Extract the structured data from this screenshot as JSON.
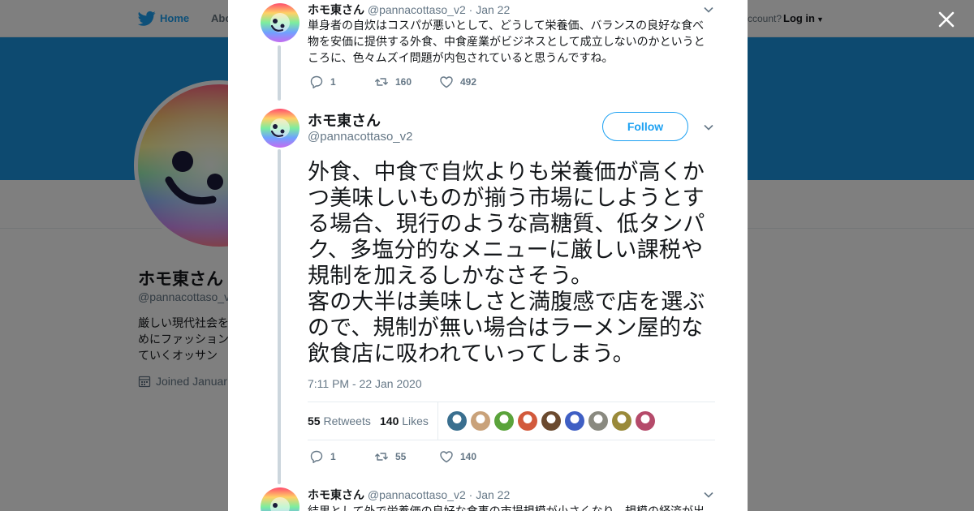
{
  "topnav": {
    "home_label": "Home",
    "about_label": "Abo",
    "account_prompt": "ccount?",
    "login_label": "Log in"
  },
  "profile": {
    "name": "ホモ東さん",
    "handle": "@pannacottaso_v",
    "bio": "厳しい現代社会を\nめにファッション\nていくオッサン",
    "joined": "Joined Januar"
  },
  "thread": {
    "prev_tweet": {
      "name": "ホモ東さん",
      "handle": "@pannacottaso_v2",
      "sep": "·",
      "date": "Jan 22",
      "text": "単身者の自炊はコスパが悪いとして、どうして栄養価、バランスの良好な食べ物を安価に提供する外食、中食産業がビジネスとして成立しないのかというところに、色々ムズイ問題が内包されていると思うんですね。",
      "replies": "1",
      "retweets": "160",
      "likes": "492"
    },
    "main_tweet": {
      "name": "ホモ東さん",
      "handle": "@pannacottaso_v2",
      "follow_label": "Follow",
      "text": "外食、中食で自炊よりも栄養価が高くかつ美味しいものが揃う市場にしようとする場合、現行のような高糖質、低タンパク、多塩分的なメニューに厳しい課税や規制を加えるしかなさそう。\n客の大半は美味しさと満腹感で店を選ぶので、規制が無い場合はラーメン屋的な飲食店に吸われていってしまう。",
      "timestamp": "7:11 PM - 22 Jan 2020",
      "retweet_count": "55",
      "retweet_label": "Retweets",
      "like_count": "140",
      "like_label": "Likes",
      "replies": "1",
      "retweets": "55",
      "likes": "140"
    },
    "next_tweet": {
      "name": "ホモ東さん",
      "handle": "@pannacottaso_v2",
      "sep": "·",
      "date": "Jan 22",
      "text": "結果として外で栄養価の良好な食事の市場規模が小さくなり、規模の経済が出"
    }
  },
  "likers": [
    {
      "color": "#3a6f8f"
    },
    {
      "color": "#c9a27a"
    },
    {
      "color": "#5aa33b"
    },
    {
      "color": "#d25a3c"
    },
    {
      "color": "#6b4a2f"
    },
    {
      "color": "#3f5fc4"
    },
    {
      "color": "#8a8a80"
    },
    {
      "color": "#9a8a3a"
    },
    {
      "color": "#b54a6a"
    }
  ],
  "colors": {
    "accent": "#1da1f2",
    "banner": "#1b95e0",
    "muted": "#657786"
  }
}
